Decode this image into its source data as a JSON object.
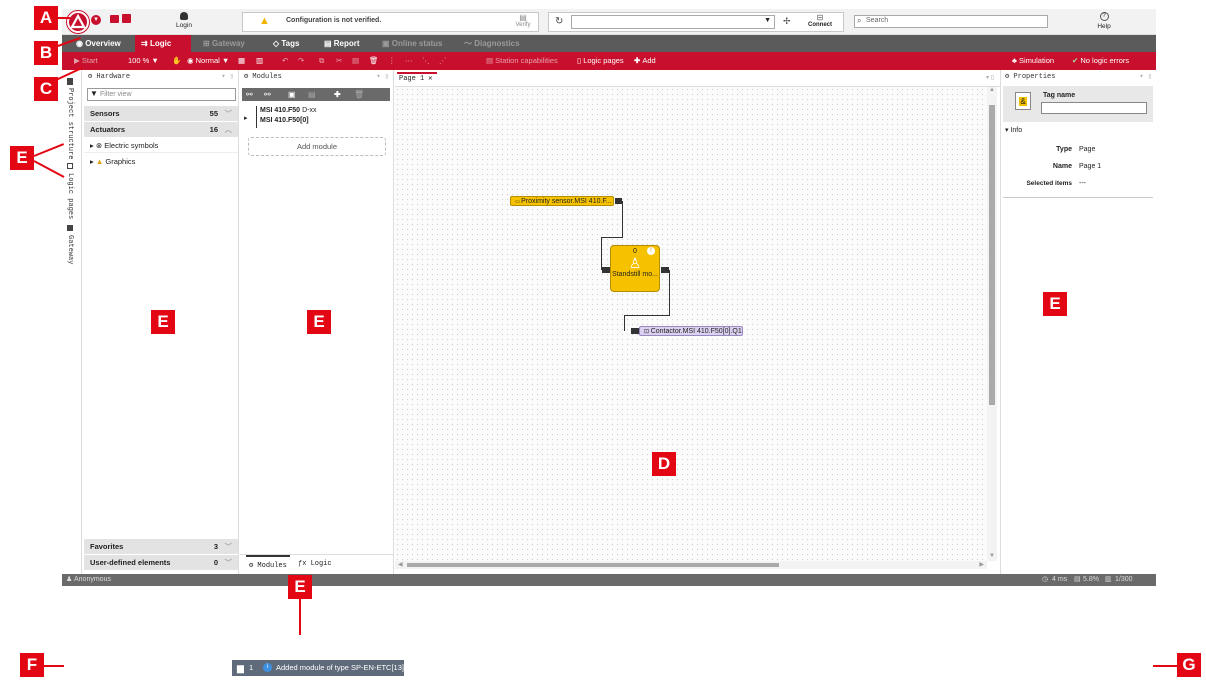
{
  "callouts": {
    "a": "A",
    "b": "B",
    "c": "C",
    "d": "D",
    "e": "E",
    "f": "F",
    "g": "G"
  },
  "colors": {
    "brand_red": "#c8102e",
    "callout_red": "#e30613",
    "tab_bar": "#5b5b5b",
    "logic_block": "#f6c200"
  },
  "topbar": {
    "login_label": "Login",
    "warning_text": "Configuration is not verified.",
    "verify_label": "Verify",
    "connect_label": "Connect",
    "search_placeholder": "Search",
    "help_label": "Help"
  },
  "tabs": [
    {
      "label": "Overview",
      "icon": "eye-icon"
    },
    {
      "label": "Logic",
      "icon": "logic-icon"
    },
    {
      "label": "Gateway",
      "icon": "gateway-icon"
    },
    {
      "label": "Tags",
      "icon": "tag-icon"
    },
    {
      "label": "Report",
      "icon": "report-icon"
    },
    {
      "label": "Online status",
      "icon": "online-icon"
    },
    {
      "label": "Diagnostics",
      "icon": "pulse-icon"
    }
  ],
  "toolbar": {
    "start": "Start",
    "zoom": "100 %",
    "mode": "Normal",
    "station_capabilities": "Station capabilities",
    "logic_pages": "Logic pages",
    "add": "Add",
    "simulation": "Simulation",
    "no_logic_errors": "No logic errors"
  },
  "vertical_tabs": {
    "project_structure": "Project structure",
    "logic_pages": "Logic pages",
    "gateway": "Gateway"
  },
  "hardware": {
    "title": "Hardware",
    "filter_placeholder": "Filter view",
    "sensors_label": "Sensors",
    "sensors_count": "55",
    "actuators_label": "Actuators",
    "actuators_count": "16",
    "electric_symbols": "Electric symbols",
    "graphics": "Graphics",
    "favorites_label": "Favorites",
    "favorites_count": "3",
    "user_defined_label": "User-defined elements",
    "user_defined_count": "0"
  },
  "modules": {
    "title": "Modules",
    "module_1_bold": "MSI 410.F50",
    "module_1_suffix": "D-xx",
    "module_2": "MSI 410.F50[0]",
    "add_module": "Add module",
    "bottom_tab_1": "Modules",
    "bottom_tab_2": "Logic"
  },
  "canvas": {
    "page_tab": "Page 1",
    "block_sensor": "Proximity sensor.MSI 410.F...",
    "block_func_count": "0",
    "block_func_label": "Standstill mo...",
    "block_actuator": "Contactor.MSI 410.F50[0].Q1"
  },
  "properties": {
    "title": "Properties",
    "tag_name_label": "Tag name",
    "info_label": "Info",
    "type_label": "Type",
    "type_value": "Page",
    "name_label": "Name",
    "name_value": "Page 1",
    "selected_label": "Selected items",
    "selected_value": "---"
  },
  "status": {
    "user": "Anonymous",
    "cycle": "4 ms",
    "load": "5.8%",
    "pages": "1/300"
  },
  "notification": {
    "count": "1",
    "message": "Added module of type SP-EN-ETC[13]"
  }
}
